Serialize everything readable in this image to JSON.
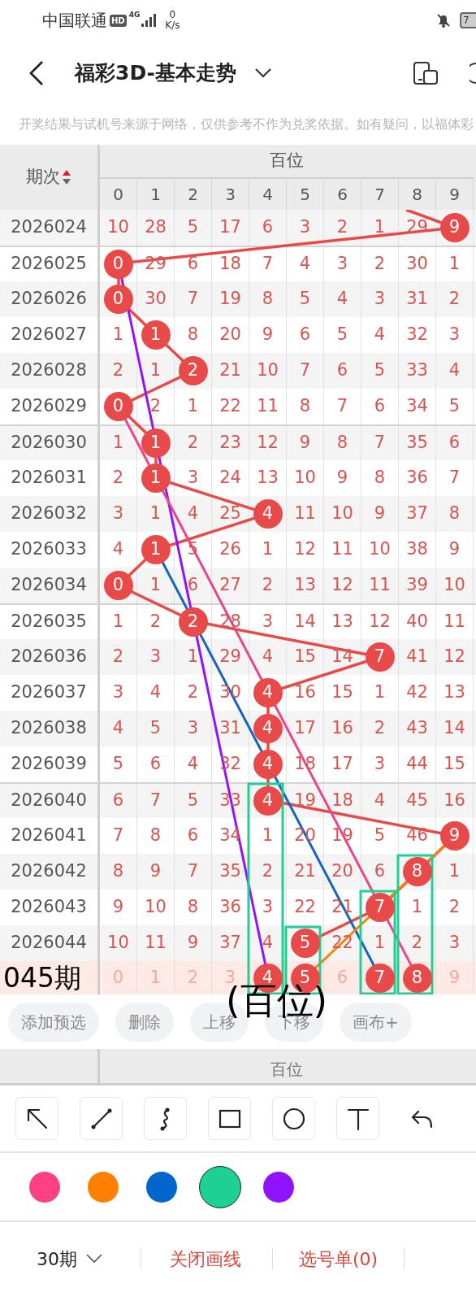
{
  "status_bar": {
    "carrier": "中国联通",
    "hd": "HD",
    "network": "4G",
    "speed_value": "0",
    "speed_unit": "K/s",
    "battery": "7"
  },
  "header": {
    "title": "福彩3D-基本走势"
  },
  "notice": "开奖结果与试机号来源于网络，仅供参考不作为兑奖依据。如有疑问，以福体彩",
  "table": {
    "period_header": "期次",
    "group_header": "百位",
    "digits": [
      "0",
      "1",
      "2",
      "3",
      "4",
      "5",
      "6",
      "7",
      "8",
      "9"
    ],
    "rows": [
      {
        "period": "2026024",
        "cells": [
          {
            "value": "10",
            "hit": false
          },
          {
            "value": "28",
            "hit": false
          },
          {
            "value": "5",
            "hit": false
          },
          {
            "value": "17",
            "hit": false
          },
          {
            "value": "6",
            "hit": false
          },
          {
            "value": "3",
            "hit": false
          },
          {
            "value": "2",
            "hit": false
          },
          {
            "value": "1",
            "hit": false
          },
          {
            "value": "29",
            "hit": false
          },
          {
            "value": "9",
            "hit": true
          }
        ]
      },
      {
        "period": "2026025",
        "cells": [
          {
            "value": "0",
            "hit": true
          },
          {
            "value": "29",
            "hit": false
          },
          {
            "value": "6",
            "hit": false
          },
          {
            "value": "18",
            "hit": false
          },
          {
            "value": "7",
            "hit": false
          },
          {
            "value": "4",
            "hit": false
          },
          {
            "value": "3",
            "hit": false
          },
          {
            "value": "2",
            "hit": false
          },
          {
            "value": "30",
            "hit": false
          },
          {
            "value": "1",
            "hit": false
          }
        ]
      },
      {
        "period": "2026026",
        "cells": [
          {
            "value": "0",
            "hit": true
          },
          {
            "value": "30",
            "hit": false
          },
          {
            "value": "7",
            "hit": false
          },
          {
            "value": "19",
            "hit": false
          },
          {
            "value": "8",
            "hit": false
          },
          {
            "value": "5",
            "hit": false
          },
          {
            "value": "4",
            "hit": false
          },
          {
            "value": "3",
            "hit": false
          },
          {
            "value": "31",
            "hit": false
          },
          {
            "value": "2",
            "hit": false
          }
        ]
      },
      {
        "period": "2026027",
        "cells": [
          {
            "value": "1",
            "hit": false
          },
          {
            "value": "1",
            "hit": true
          },
          {
            "value": "8",
            "hit": false
          },
          {
            "value": "20",
            "hit": false
          },
          {
            "value": "9",
            "hit": false
          },
          {
            "value": "6",
            "hit": false
          },
          {
            "value": "5",
            "hit": false
          },
          {
            "value": "4",
            "hit": false
          },
          {
            "value": "32",
            "hit": false
          },
          {
            "value": "3",
            "hit": false
          }
        ]
      },
      {
        "period": "2026028",
        "cells": [
          {
            "value": "2",
            "hit": false
          },
          {
            "value": "1",
            "hit": false
          },
          {
            "value": "2",
            "hit": true
          },
          {
            "value": "21",
            "hit": false
          },
          {
            "value": "10",
            "hit": false
          },
          {
            "value": "7",
            "hit": false
          },
          {
            "value": "6",
            "hit": false
          },
          {
            "value": "5",
            "hit": false
          },
          {
            "value": "33",
            "hit": false
          },
          {
            "value": "4",
            "hit": false
          }
        ]
      },
      {
        "period": "2026029",
        "cells": [
          {
            "value": "0",
            "hit": true
          },
          {
            "value": "2",
            "hit": false
          },
          {
            "value": "1",
            "hit": false
          },
          {
            "value": "22",
            "hit": false
          },
          {
            "value": "11",
            "hit": false
          },
          {
            "value": "8",
            "hit": false
          },
          {
            "value": "7",
            "hit": false
          },
          {
            "value": "6",
            "hit": false
          },
          {
            "value": "34",
            "hit": false
          },
          {
            "value": "5",
            "hit": false
          }
        ]
      },
      {
        "period": "2026030",
        "cells": [
          {
            "value": "1",
            "hit": false
          },
          {
            "value": "1",
            "hit": true
          },
          {
            "value": "2",
            "hit": false
          },
          {
            "value": "23",
            "hit": false
          },
          {
            "value": "12",
            "hit": false
          },
          {
            "value": "9",
            "hit": false
          },
          {
            "value": "8",
            "hit": false
          },
          {
            "value": "7",
            "hit": false
          },
          {
            "value": "35",
            "hit": false
          },
          {
            "value": "6",
            "hit": false
          }
        ]
      },
      {
        "period": "2026031",
        "cells": [
          {
            "value": "2",
            "hit": false
          },
          {
            "value": "1",
            "hit": true
          },
          {
            "value": "3",
            "hit": false
          },
          {
            "value": "24",
            "hit": false
          },
          {
            "value": "13",
            "hit": false
          },
          {
            "value": "10",
            "hit": false
          },
          {
            "value": "9",
            "hit": false
          },
          {
            "value": "8",
            "hit": false
          },
          {
            "value": "36",
            "hit": false
          },
          {
            "value": "7",
            "hit": false
          }
        ]
      },
      {
        "period": "2026032",
        "cells": [
          {
            "value": "3",
            "hit": false
          },
          {
            "value": "1",
            "hit": false
          },
          {
            "value": "4",
            "hit": false
          },
          {
            "value": "25",
            "hit": false
          },
          {
            "value": "4",
            "hit": true
          },
          {
            "value": "11",
            "hit": false
          },
          {
            "value": "10",
            "hit": false
          },
          {
            "value": "9",
            "hit": false
          },
          {
            "value": "37",
            "hit": false
          },
          {
            "value": "8",
            "hit": false
          }
        ]
      },
      {
        "period": "2026033",
        "cells": [
          {
            "value": "4",
            "hit": false
          },
          {
            "value": "1",
            "hit": true
          },
          {
            "value": "5",
            "hit": false
          },
          {
            "value": "26",
            "hit": false
          },
          {
            "value": "1",
            "hit": false
          },
          {
            "value": "12",
            "hit": false
          },
          {
            "value": "11",
            "hit": false
          },
          {
            "value": "10",
            "hit": false
          },
          {
            "value": "38",
            "hit": false
          },
          {
            "value": "9",
            "hit": false
          }
        ]
      },
      {
        "period": "2026034",
        "cells": [
          {
            "value": "0",
            "hit": true
          },
          {
            "value": "1",
            "hit": false
          },
          {
            "value": "6",
            "hit": false
          },
          {
            "value": "27",
            "hit": false
          },
          {
            "value": "2",
            "hit": false
          },
          {
            "value": "13",
            "hit": false
          },
          {
            "value": "12",
            "hit": false
          },
          {
            "value": "11",
            "hit": false
          },
          {
            "value": "39",
            "hit": false
          },
          {
            "value": "10",
            "hit": false
          }
        ]
      },
      {
        "period": "2026035",
        "cells": [
          {
            "value": "1",
            "hit": false
          },
          {
            "value": "2",
            "hit": false
          },
          {
            "value": "2",
            "hit": true
          },
          {
            "value": "28",
            "hit": false
          },
          {
            "value": "3",
            "hit": false
          },
          {
            "value": "14",
            "hit": false
          },
          {
            "value": "13",
            "hit": false
          },
          {
            "value": "12",
            "hit": false
          },
          {
            "value": "40",
            "hit": false
          },
          {
            "value": "11",
            "hit": false
          }
        ]
      },
      {
        "period": "2026036",
        "cells": [
          {
            "value": "2",
            "hit": false
          },
          {
            "value": "3",
            "hit": false
          },
          {
            "value": "1",
            "hit": false
          },
          {
            "value": "29",
            "hit": false
          },
          {
            "value": "4",
            "hit": false
          },
          {
            "value": "15",
            "hit": false
          },
          {
            "value": "14",
            "hit": false
          },
          {
            "value": "7",
            "hit": true
          },
          {
            "value": "41",
            "hit": false
          },
          {
            "value": "12",
            "hit": false
          }
        ]
      },
      {
        "period": "2026037",
        "cells": [
          {
            "value": "3",
            "hit": false
          },
          {
            "value": "4",
            "hit": false
          },
          {
            "value": "2",
            "hit": false
          },
          {
            "value": "30",
            "hit": false
          },
          {
            "value": "4",
            "hit": true
          },
          {
            "value": "16",
            "hit": false
          },
          {
            "value": "15",
            "hit": false
          },
          {
            "value": "1",
            "hit": false
          },
          {
            "value": "42",
            "hit": false
          },
          {
            "value": "13",
            "hit": false
          }
        ]
      },
      {
        "period": "2026038",
        "cells": [
          {
            "value": "4",
            "hit": false
          },
          {
            "value": "5",
            "hit": false
          },
          {
            "value": "3",
            "hit": false
          },
          {
            "value": "31",
            "hit": false
          },
          {
            "value": "4",
            "hit": true
          },
          {
            "value": "17",
            "hit": false
          },
          {
            "value": "16",
            "hit": false
          },
          {
            "value": "2",
            "hit": false
          },
          {
            "value": "43",
            "hit": false
          },
          {
            "value": "14",
            "hit": false
          }
        ]
      },
      {
        "period": "2026039",
        "cells": [
          {
            "value": "5",
            "hit": false
          },
          {
            "value": "6",
            "hit": false
          },
          {
            "value": "4",
            "hit": false
          },
          {
            "value": "32",
            "hit": false
          },
          {
            "value": "4",
            "hit": true
          },
          {
            "value": "18",
            "hit": false
          },
          {
            "value": "17",
            "hit": false
          },
          {
            "value": "3",
            "hit": false
          },
          {
            "value": "44",
            "hit": false
          },
          {
            "value": "15",
            "hit": false
          }
        ]
      },
      {
        "period": "2026040",
        "cells": [
          {
            "value": "6",
            "hit": false
          },
          {
            "value": "7",
            "hit": false
          },
          {
            "value": "5",
            "hit": false
          },
          {
            "value": "33",
            "hit": false
          },
          {
            "value": "4",
            "hit": true
          },
          {
            "value": "19",
            "hit": false
          },
          {
            "value": "18",
            "hit": false
          },
          {
            "value": "4",
            "hit": false
          },
          {
            "value": "45",
            "hit": false
          },
          {
            "value": "16",
            "hit": false
          }
        ]
      },
      {
        "period": "2026041",
        "cells": [
          {
            "value": "7",
            "hit": false
          },
          {
            "value": "8",
            "hit": false
          },
          {
            "value": "6",
            "hit": false
          },
          {
            "value": "34",
            "hit": false
          },
          {
            "value": "1",
            "hit": false
          },
          {
            "value": "20",
            "hit": false
          },
          {
            "value": "19",
            "hit": false
          },
          {
            "value": "5",
            "hit": false
          },
          {
            "value": "46",
            "hit": false
          },
          {
            "value": "9",
            "hit": true
          }
        ]
      },
      {
        "period": "2026042",
        "cells": [
          {
            "value": "8",
            "hit": false
          },
          {
            "value": "9",
            "hit": false
          },
          {
            "value": "7",
            "hit": false
          },
          {
            "value": "35",
            "hit": false
          },
          {
            "value": "2",
            "hit": false
          },
          {
            "value": "21",
            "hit": false
          },
          {
            "value": "20",
            "hit": false
          },
          {
            "value": "6",
            "hit": false
          },
          {
            "value": "8",
            "hit": true
          },
          {
            "value": "1",
            "hit": false
          }
        ]
      },
      {
        "period": "2026043",
        "cells": [
          {
            "value": "9",
            "hit": false
          },
          {
            "value": "10",
            "hit": false
          },
          {
            "value": "8",
            "hit": false
          },
          {
            "value": "36",
            "hit": false
          },
          {
            "value": "3",
            "hit": false
          },
          {
            "value": "22",
            "hit": false
          },
          {
            "value": "21",
            "hit": false
          },
          {
            "value": "7",
            "hit": true
          },
          {
            "value": "1",
            "hit": false
          },
          {
            "value": "2",
            "hit": false
          }
        ]
      },
      {
        "period": "2026044",
        "cells": [
          {
            "value": "10",
            "hit": false
          },
          {
            "value": "11",
            "hit": false
          },
          {
            "value": "9",
            "hit": false
          },
          {
            "value": "37",
            "hit": false
          },
          {
            "value": "4",
            "hit": false
          },
          {
            "value": "5",
            "hit": true
          },
          {
            "value": "22",
            "hit": false
          },
          {
            "value": "1",
            "hit": false
          },
          {
            "value": "2",
            "hit": false
          },
          {
            "value": "3",
            "hit": false
          }
        ]
      }
    ],
    "prediction": {
      "label": "045期",
      "cells": [
        {
          "value": "0",
          "selected": false
        },
        {
          "value": "1",
          "selected": false
        },
        {
          "value": "2",
          "selected": false
        },
        {
          "value": "3",
          "selected": false
        },
        {
          "value": "4",
          "selected": true
        },
        {
          "value": "5",
          "selected": true
        },
        {
          "value": "6",
          "selected": false
        },
        {
          "value": "7",
          "selected": true
        },
        {
          "value": "8",
          "selected": true
        },
        {
          "value": "9",
          "selected": false
        }
      ]
    }
  },
  "overlay_text": "(百位)",
  "actions": [
    "添加预选",
    "删除",
    "上移",
    "下移",
    "画布+"
  ],
  "footer_header": "百位",
  "tools": [
    {
      "kind": "arrow"
    },
    {
      "kind": "line"
    },
    {
      "kind": "curve"
    },
    {
      "kind": "rect"
    },
    {
      "kind": "circle"
    },
    {
      "kind": "text"
    },
    {
      "kind": "undo"
    }
  ],
  "colors": [
    {
      "color": "#ff4081",
      "selected": false
    },
    {
      "color": "#ff7f00",
      "selected": false
    },
    {
      "color": "#0066cc",
      "selected": false
    },
    {
      "color": "#1ed094",
      "selected": true
    },
    {
      "color": "#9013fe",
      "selected": false
    }
  ],
  "bottom_bar": {
    "period_select": "30期",
    "close_drawing": "关闭画线",
    "pick_list": "选号单(0)"
  }
}
